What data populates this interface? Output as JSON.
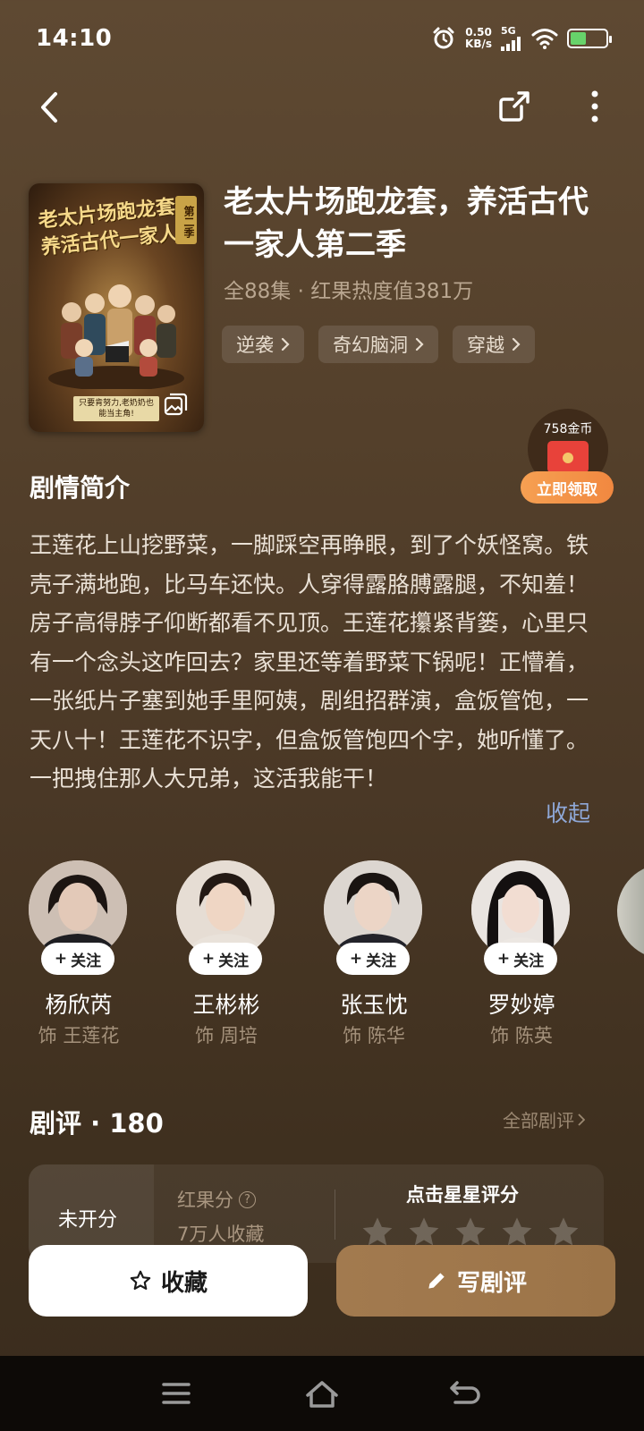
{
  "status_bar": {
    "time": "14:10",
    "net_speed_value": "0.50",
    "net_speed_unit": "KB/s",
    "signal_label": "5G",
    "battery_level": 0.45,
    "battery_color": "#67d36a"
  },
  "nav": {
    "back_icon": "chevron-left-icon",
    "share_icon": "share-icon",
    "more_icon": "more-vertical-icon"
  },
  "poster": {
    "title_line1": "老太片场跑龙套,",
    "title_line2": "养活古代一家人",
    "season": "第二季",
    "caption": "只要肯努力,老奶奶也能当主角!",
    "icon": "image-preview-icon"
  },
  "show": {
    "title": "老太片场跑龙套，养活古代一家人第二季",
    "meta": "全88集 · 红果热度值381万",
    "tags": [
      {
        "label": "逆袭"
      },
      {
        "label": "奇幻脑洞"
      },
      {
        "label": "穿越"
      }
    ]
  },
  "coin_reward": {
    "amount": "758金币",
    "cta": "立即领取"
  },
  "synopsis": {
    "heading": "剧情简介",
    "text": "王莲花上山挖野菜，一脚踩空再睁眼，到了个妖怪窝。铁壳子满地跑，比马车还快。人穿得露胳膊露腿，不知羞！房子高得脖子仰断都看不见顶。王莲花攥紧背篓，心里只有一个念头这咋回去？家里还等着野菜下锅呢！正懵着，一张纸片子塞到她手里阿姨，剧组招群演，盒饭管饱，一天八十！王莲花不识字，但盒饭管饱四个字，她听懂了。一把拽住那人大兄弟，这活我能干！",
    "collapse": "收起"
  },
  "cast": [
    {
      "name": "杨欣芮",
      "role": "饰 王莲花",
      "follow": "关注",
      "skin": "#e3c9b8",
      "hair": "#1c1512",
      "shirt": "#1e1e22"
    },
    {
      "name": "王彬彬",
      "role": "饰 周培",
      "follow": "关注",
      "skin": "#efd6c4",
      "hair": "#231914",
      "shirt": "#e9e2da"
    },
    {
      "name": "张玉忱",
      "role": "饰 陈华",
      "follow": "关注",
      "skin": "#ecd5c6",
      "hair": "#1a1411",
      "shirt": "#23232a"
    },
    {
      "name": "罗妙婷",
      "role": "饰 陈英",
      "follow": "关注",
      "skin": "#f2ddd2",
      "hair": "#141010",
      "shirt": "#ece7e2"
    }
  ],
  "reviews": {
    "heading": "剧评 · 180",
    "all_link": "全部剧评",
    "unrated": "未开分",
    "score_label": "红果分",
    "collect_count": "7万人收藏",
    "tap_to_rate": "点击星星评分",
    "star_count": 5
  },
  "actions": {
    "collect": "收藏",
    "write_review": "写剧评"
  }
}
